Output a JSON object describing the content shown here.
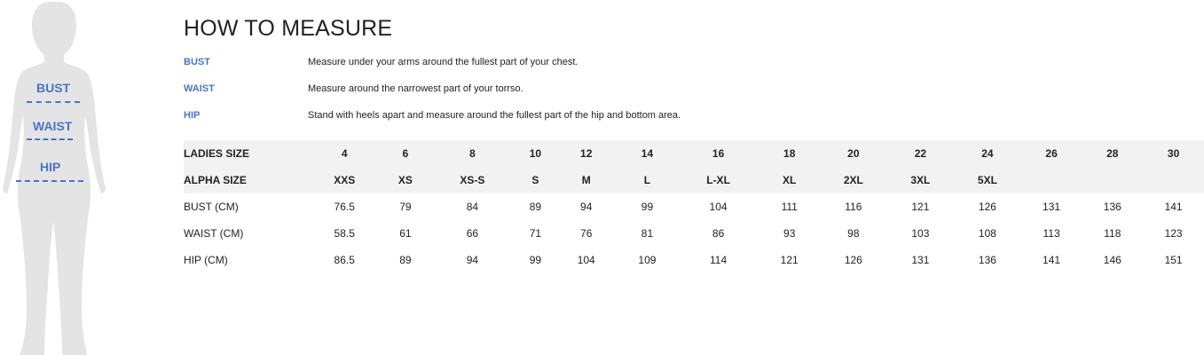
{
  "figure": {
    "labels": {
      "bust": "BUST",
      "waist": "WAIST",
      "hip": "HIP"
    },
    "accent_color": "#4a73c9",
    "silhouette_color": "#e4e4e4"
  },
  "title": "HOW TO MEASURE",
  "measures": [
    {
      "key": "BUST",
      "desc": "Measure under your arms around the fullest part of your chest."
    },
    {
      "key": "WAIST",
      "desc": "Measure around the narrowest part of your torrso."
    },
    {
      "key": "HIP",
      "desc": "Stand with heels apart and measure around the fullest part of the hip and bottom area."
    }
  ],
  "table": {
    "rows": [
      {
        "label": "LADIES SIZE",
        "shaded": true,
        "cells": [
          "4",
          "6",
          "8",
          "10",
          "12",
          "14",
          "16",
          "18",
          "20",
          "22",
          "24",
          "26",
          "28",
          "30"
        ]
      },
      {
        "label": "ALPHA SIZE",
        "shaded": true,
        "cells": [
          "XXS",
          "XS",
          "XS-S",
          "S",
          "M",
          "L",
          "L-XL",
          "XL",
          "2XL",
          "3XL",
          "5XL",
          "",
          "",
          ""
        ]
      },
      {
        "label": "BUST (CM)",
        "shaded": false,
        "cells": [
          "76.5",
          "79",
          "84",
          "89",
          "94",
          "99",
          "104",
          "111",
          "116",
          "121",
          "126",
          "131",
          "136",
          "141"
        ]
      },
      {
        "label": "WAIST (CM)",
        "shaded": false,
        "cells": [
          "58.5",
          "61",
          "66",
          "71",
          "76",
          "81",
          "86",
          "93",
          "98",
          "103",
          "108",
          "113",
          "118",
          "123"
        ]
      },
      {
        "label": "HIP (CM)",
        "shaded": false,
        "cells": [
          "86.5",
          "89",
          "94",
          "99",
          "104",
          "109",
          "114",
          "121",
          "126",
          "131",
          "136",
          "141",
          "146",
          "151"
        ]
      }
    ]
  }
}
